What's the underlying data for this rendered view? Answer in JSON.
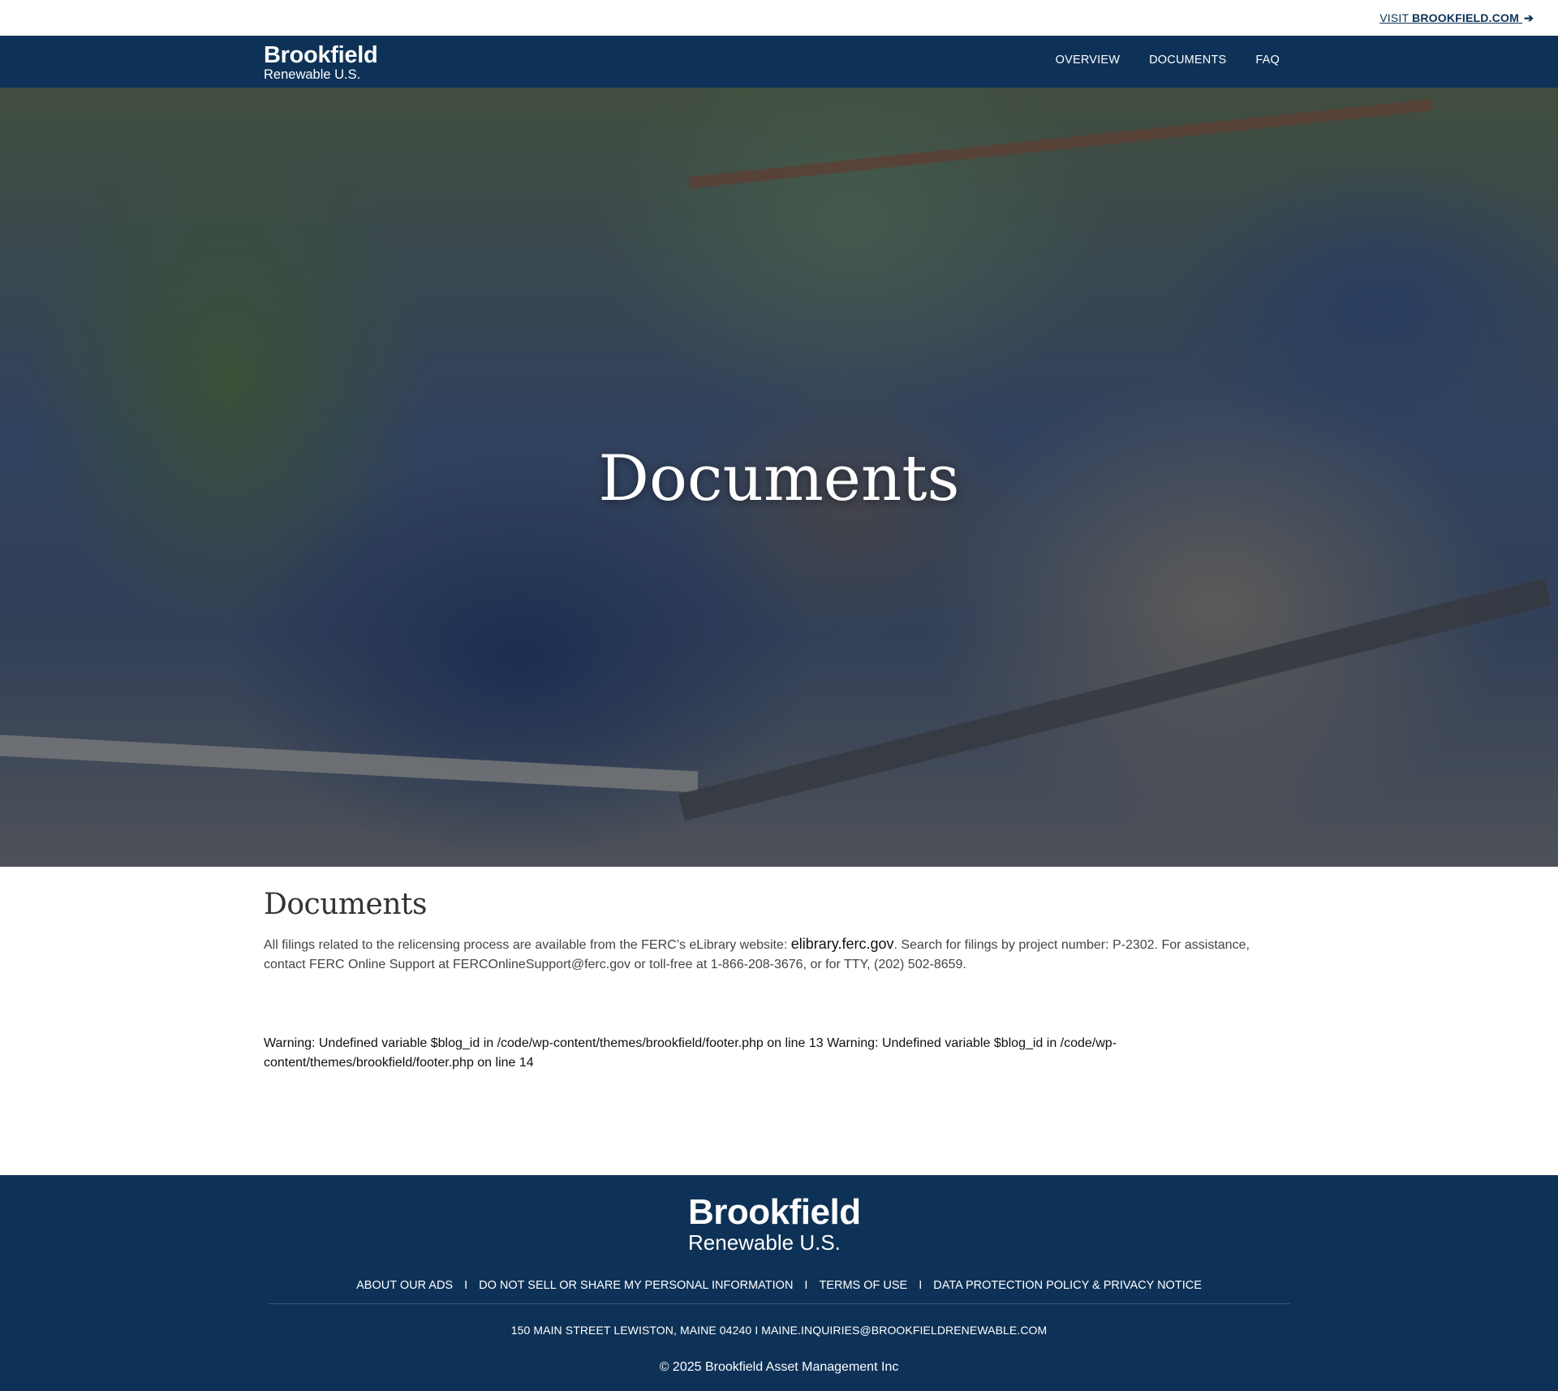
{
  "utility": {
    "visit_prefix": "VISIT ",
    "visit_site": "BROOKFIELD.COM",
    "visit_arrow": "➔"
  },
  "header": {
    "logo_main": "Brookfield",
    "logo_sub": "Renewable U.S.",
    "nav": [
      {
        "label": "OVERVIEW"
      },
      {
        "label": "DOCUMENTS"
      },
      {
        "label": "FAQ"
      }
    ]
  },
  "hero": {
    "title": "Documents"
  },
  "main": {
    "heading": "Documents",
    "intro_before": "All filings related to the relicensing process are available from the FERC’s eLibrary website: ",
    "intro_link": "elibrary.ferc.gov",
    "intro_after": ". Search for filings by project number: P-2302. For assistance, contact FERC Online Support at FERCOnlineSupport@ferc.gov or toll-free at 1-866-208-3676, or for TTY, (202) 502-8659.",
    "warning": "Warning: Undefined variable $blog_id in /code/wp-content/themes/brookfield/footer.php on line 13 Warning: Undefined variable $blog_id in /code/wp-content/themes/brookfield/footer.php on line 14"
  },
  "footer": {
    "logo_main": "Brookfield",
    "logo_sub": "Renewable U.S.",
    "links": [
      {
        "label": "ABOUT OUR ADS"
      },
      {
        "label": "DO NOT SELL OR SHARE MY PERSONAL INFORMATION"
      },
      {
        "label": "TERMS OF USE"
      },
      {
        "label": "DATA PROTECTION POLICY & PRIVACY NOTICE"
      }
    ],
    "separator": "I",
    "address": "150 MAIN STREET LEWISTON, MAINE 04240 I MAINE.INQUIRIES@BROOKFIELDRENEWABLE.COM",
    "copyright": "© 2025 Brookfield Asset Management Inc"
  },
  "colors": {
    "brand_navy": "#0e3257",
    "white": "#ffffff",
    "body_text": "#444444"
  }
}
